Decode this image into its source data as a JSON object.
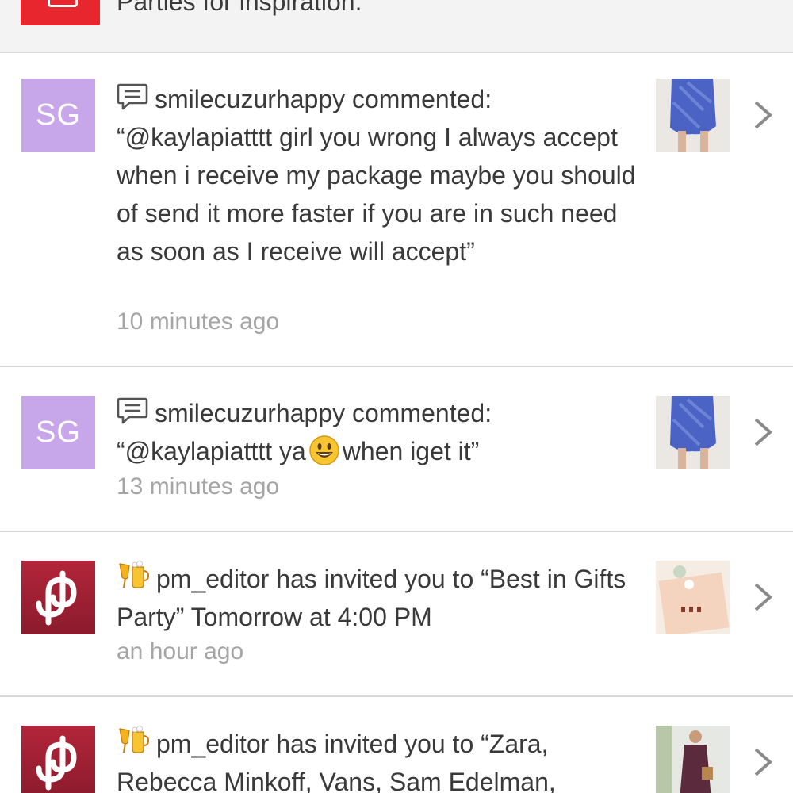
{
  "banner": {
    "text": "Parties for inspiration."
  },
  "notifications": [
    {
      "avatar_initials": "SG",
      "action_text": "smilecuzurhappy commented:",
      "message": "“@kaylapiatttt girl you wrong I always accept when i receive my package maybe you should of send it more faster if you are in such need as soon as I receive will accept”",
      "time": "10 minutes ago",
      "icon": "comment-icon"
    },
    {
      "avatar_initials": "SG",
      "action_text": "smilecuzurhappy commented:",
      "message_before": "“@kaylapiatttt ya",
      "message_after": "when iget it”",
      "emoji": "smiley-emoji",
      "time": "13 minutes ago",
      "icon": "comment-icon"
    },
    {
      "action_text": "pm_editor has invited you to “Best in Gifts Party” Tomorrow at 4:00 PM",
      "time": "an hour ago",
      "icon": "party-drinks-icon"
    },
    {
      "action_text": "pm_editor has invited you to “Zara, Rebecca Minkoff, Vans, Sam Edelman,",
      "icon": "party-drinks-icon"
    }
  ],
  "colors": {
    "avatar_purple": "#c7a6ea",
    "brand_red": "#9d1f33",
    "timestamp_gray": "#a5a5a5",
    "divider": "#d9d9d9",
    "banner_red": "#e8262d"
  }
}
